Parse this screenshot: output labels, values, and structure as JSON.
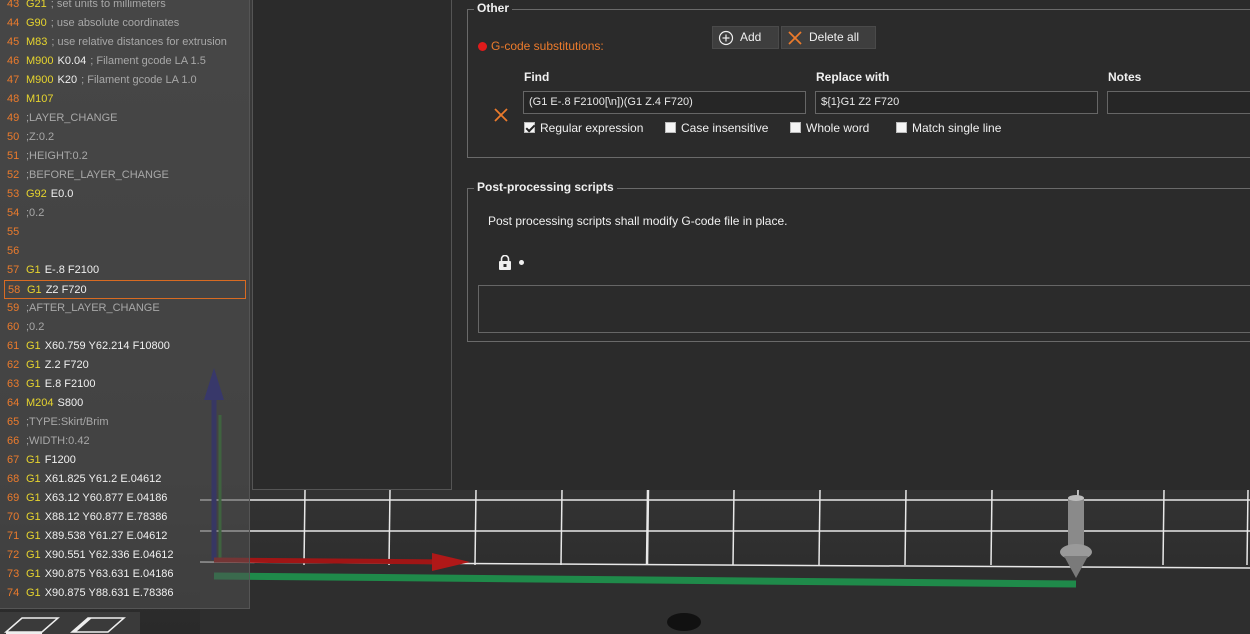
{
  "gcode": {
    "lines": [
      {
        "num": "43",
        "cmd": "G21",
        "args": "",
        "comment": "; set units to millimeters"
      },
      {
        "num": "44",
        "cmd": "G90",
        "args": "",
        "comment": "; use absolute coordinates"
      },
      {
        "num": "45",
        "cmd": "M83",
        "args": "",
        "comment": "; use relative distances for extrusion"
      },
      {
        "num": "46",
        "cmd": "M900",
        "args": "K0.04",
        "comment": "; Filament gcode LA 1.5"
      },
      {
        "num": "47",
        "cmd": "M900",
        "args": "K20",
        "comment": "; Filament gcode LA 1.0"
      },
      {
        "num": "48",
        "cmd": "M107",
        "args": "",
        "comment": ""
      },
      {
        "num": "49",
        "cmd": "",
        "args": "",
        "comment": ";LAYER_CHANGE"
      },
      {
        "num": "50",
        "cmd": "",
        "args": "",
        "comment": ";Z:0.2"
      },
      {
        "num": "51",
        "cmd": "",
        "args": "",
        "comment": ";HEIGHT:0.2"
      },
      {
        "num": "52",
        "cmd": "",
        "args": "",
        "comment": ";BEFORE_LAYER_CHANGE"
      },
      {
        "num": "53",
        "cmd": "G92",
        "args": "E0.0",
        "comment": ""
      },
      {
        "num": "54",
        "cmd": "",
        "args": "",
        "comment": ";0.2"
      },
      {
        "num": "55",
        "cmd": "",
        "args": "",
        "comment": ""
      },
      {
        "num": "56",
        "cmd": "",
        "args": "",
        "comment": ""
      },
      {
        "num": "57",
        "cmd": "G1",
        "args": "E-.8 F2100",
        "comment": ""
      },
      {
        "num": "58",
        "cmd": "G1",
        "args": "Z2 F720",
        "comment": ""
      },
      {
        "num": "59",
        "cmd": "",
        "args": "",
        "comment": ";AFTER_LAYER_CHANGE"
      },
      {
        "num": "60",
        "cmd": "",
        "args": "",
        "comment": ";0.2"
      },
      {
        "num": "61",
        "cmd": "G1",
        "args": "X60.759 Y62.214 F10800",
        "comment": ""
      },
      {
        "num": "62",
        "cmd": "G1",
        "args": "Z.2 F720",
        "comment": ""
      },
      {
        "num": "63",
        "cmd": "G1",
        "args": "E.8 F2100",
        "comment": ""
      },
      {
        "num": "64",
        "cmd": "M204",
        "args": "S800",
        "comment": ""
      },
      {
        "num": "65",
        "cmd": "",
        "args": "",
        "comment": ";TYPE:Skirt/Brim"
      },
      {
        "num": "66",
        "cmd": "",
        "args": "",
        "comment": ";WIDTH:0.42"
      },
      {
        "num": "67",
        "cmd": "G1",
        "args": "F1200",
        "comment": ""
      },
      {
        "num": "68",
        "cmd": "G1",
        "args": "X61.825 Y61.2 E.04612",
        "comment": ""
      },
      {
        "num": "69",
        "cmd": "G1",
        "args": "X63.12 Y60.877 E.04186",
        "comment": ""
      },
      {
        "num": "70",
        "cmd": "G1",
        "args": "X88.12 Y60.877 E.78386",
        "comment": ""
      },
      {
        "num": "71",
        "cmd": "G1",
        "args": "X89.538 Y61.27 E.04612",
        "comment": ""
      },
      {
        "num": "72",
        "cmd": "G1",
        "args": "X90.551 Y62.336 E.04612",
        "comment": ""
      },
      {
        "num": "73",
        "cmd": "G1",
        "args": "X90.875 Y63.631 E.04186",
        "comment": ""
      },
      {
        "num": "74",
        "cmd": "G1",
        "args": "X90.875 Y88.631 E.78386",
        "comment": ""
      }
    ],
    "selected_line": "58"
  },
  "other_group": {
    "title": "Other",
    "substitutions_label": "G-code substitutions:",
    "add_label": "Add",
    "delete_all_label": "Delete all",
    "columns": {
      "find": "Find",
      "replace": "Replace with",
      "notes": "Notes"
    },
    "find_value": "(G1 E-.8 F2100[\\n])(G1 Z.4 F720)",
    "replace_value": "${1}G1 Z2 F720",
    "notes_value": "",
    "options": [
      {
        "label": "Regular expression",
        "checked": true
      },
      {
        "label": "Case insensitive",
        "checked": false
      },
      {
        "label": "Whole word",
        "checked": false
      },
      {
        "label": "Match single line",
        "checked": false
      }
    ]
  },
  "post_processing": {
    "title": "Post-processing scripts",
    "description": "Post processing scripts shall modify G-code file in place.",
    "scripts_value": ""
  },
  "colors": {
    "accent": "#ec7b2c",
    "gcode_cmd": "#e6d42e",
    "status_red": "#e01b1b"
  }
}
